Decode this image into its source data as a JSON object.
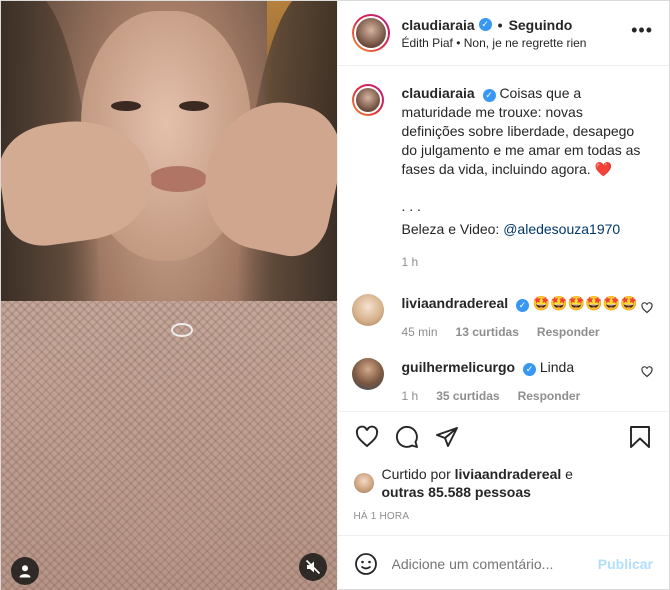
{
  "header": {
    "username": "claudiaraia",
    "separator": "•",
    "follow_status": "Seguindo",
    "music_line": "Édith Piaf • Non, je ne regrette rien",
    "more_icon": "more-dots-icon"
  },
  "caption": {
    "username": "claudiaraia",
    "text": "Coisas que a maturidade me trouxe: novas definições sobre liberdade, desapego do julgamento e me amar em todas as fases da vida, incluindo agora. ❤️",
    "dots": ". . .",
    "credit_prefix": "Beleza e Video: ",
    "credit_mention": "@aledesouza1970",
    "time": "1 h"
  },
  "comments": [
    {
      "username": "liviaandradereal",
      "text": "🤩🤩🤩🤩🤩🤩",
      "time": "45 min",
      "likes": "13 curtidas",
      "reply": "Responder"
    },
    {
      "username": "guilhermelicurgo",
      "text": "Linda",
      "time": "1 h",
      "likes": "35 curtidas",
      "reply": "Responder"
    }
  ],
  "likes": {
    "prefix": "Curtido por ",
    "user": "liviaandradereal",
    "middle": " e",
    "others": "outras 85.588 pessoas"
  },
  "time_ago": "HÁ 1 HORA",
  "add_comment": {
    "placeholder": "Adicione um comentário...",
    "publish": "Publicar"
  },
  "colors": {
    "verified": "#3897f0",
    "muted_text": "#8e8e8e",
    "publish_disabled": "#b2dffc",
    "mention": "#00376b"
  }
}
